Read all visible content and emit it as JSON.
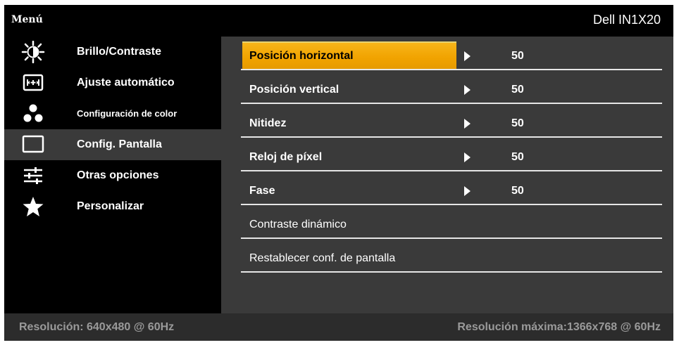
{
  "header": {
    "menu_title": "Menú",
    "model": "Dell IN1X20"
  },
  "sidebar": {
    "items": [
      {
        "label": "Brillo/Contraste",
        "icon": "brightness-icon"
      },
      {
        "label": "Ajuste  automático",
        "icon": "auto-adjust-icon"
      },
      {
        "label": "Configuración de color",
        "icon": "color-settings-icon"
      },
      {
        "label": "Config. Pantalla",
        "icon": "display-settings-icon",
        "active": true
      },
      {
        "label": "Otras opciones",
        "icon": "other-settings-icon"
      },
      {
        "label": "Personalizar",
        "icon": "star-icon"
      }
    ]
  },
  "settings": {
    "rows": [
      {
        "label": "Posición horizontal",
        "value": "50",
        "selected": true
      },
      {
        "label": "Posición vertical",
        "value": "50"
      },
      {
        "label": "Nitidez",
        "value": "50"
      },
      {
        "label": "Reloj de píxel",
        "value": "50"
      },
      {
        "label": "Fase",
        "value": "50"
      },
      {
        "label": "Contraste dinámico"
      },
      {
        "label": "Restablecer conf. de pantalla"
      }
    ]
  },
  "footer": {
    "resolution": "Resolución:  640x480 @ 60Hz",
    "max_resolution": "Resolución máxima:1366x768 @ 60Hz"
  },
  "colors": {
    "highlight": "#f1a300",
    "panel": "#3a3a3a",
    "footer": "#2c2c2c",
    "footer_text": "#9a9a9a"
  }
}
